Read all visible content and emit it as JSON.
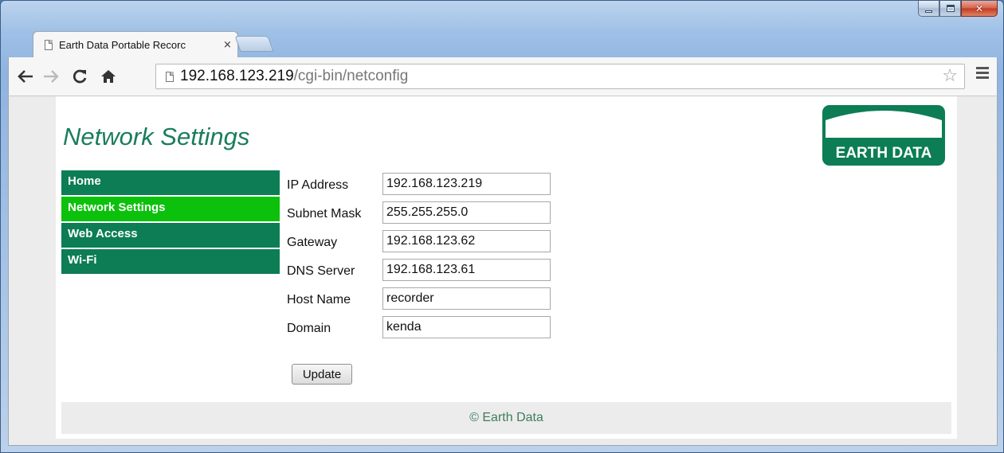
{
  "browser": {
    "tab_title": "Earth Data Portable Recorc",
    "tab_close": "×",
    "url_host": "192.168.123.219",
    "url_path": "/cgi-bin/netconfig",
    "icons": [
      "back-icon",
      "forward-icon",
      "reload-icon",
      "home-icon",
      "page-icon",
      "star-icon",
      "menu-icon",
      "minimize-icon",
      "maximize-icon",
      "close-icon"
    ]
  },
  "page": {
    "title": "Network Settings",
    "logo_text": "EARTH DATA",
    "brand_color": "#0c7d55",
    "active_color": "#0cc10c",
    "nav": [
      {
        "label": "Home",
        "active": false
      },
      {
        "label": "Network Settings",
        "active": true
      },
      {
        "label": "Web Access",
        "active": false
      },
      {
        "label": "Wi-Fi",
        "active": false
      }
    ],
    "form": {
      "ip_label": "IP Address",
      "ip_value": "192.168.123.219",
      "subnet_label": "Subnet Mask",
      "subnet_value": "255.255.255.0",
      "gateway_label": "Gateway",
      "gateway_value": "192.168.123.62",
      "dns_label": "DNS Server",
      "dns_value": "192.168.123.61",
      "host_label": "Host Name",
      "host_value": "recorder",
      "domain_label": "Domain",
      "domain_value": "kenda"
    },
    "update_label": "Update",
    "footer": "© Earth Data"
  }
}
